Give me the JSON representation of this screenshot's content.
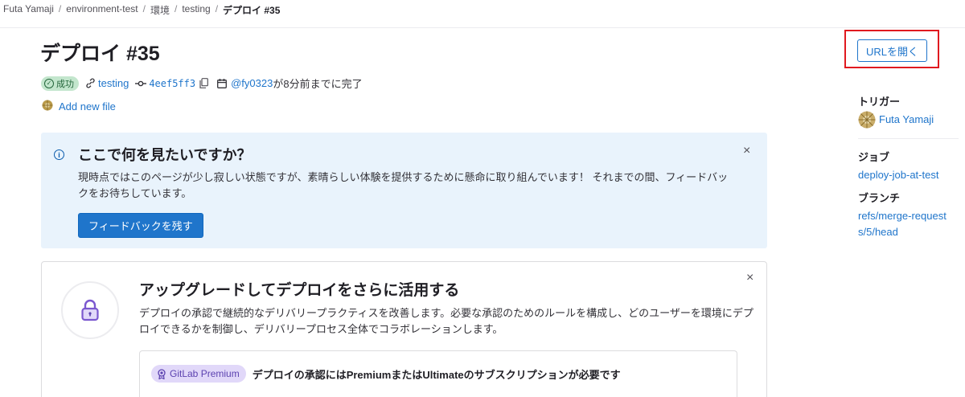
{
  "breadcrumb": [
    "Futa Yamaji",
    "environment-test",
    "環境",
    "testing",
    "デプロイ #35"
  ],
  "page": {
    "title": "デプロイ #35",
    "status": "成功",
    "environment": "testing",
    "commit": "4eef5ff3",
    "finished_by": "@fy0323",
    "finished_suffix": "が8分前までに完了",
    "add_file": "Add new file"
  },
  "feedback": {
    "title": "ここで何を見たいですか？",
    "body": "現時点ではこのページが少し寂しい状態ですが、素晴らしい体験を提供するために懸命に取り組んでいます！ それまでの間、フィードバックをお待ちしています。",
    "button": "フィードバックを残す"
  },
  "upgrade": {
    "title": "アップグレードしてデプロイをさらに活用する",
    "body": "デプロイの承認で継続的なデリバリープラクティスを改善します。必要な承認のためのルールを構成し、どのユーザーを環境にデプロイできるかを制御し、デリバリープロセス全体でコラボレーションします。",
    "premium_badge": "GitLab Premium",
    "premium_text": "デプロイの承認にはPremiumまたはUltimateのサブスクリプションが必要です"
  },
  "sidebar": {
    "open_url": "URLを開く",
    "trigger_label": "トリガー",
    "trigger_user": "Futa Yamaji",
    "job_label": "ジョブ",
    "job": "deploy-job-at-test",
    "branch_label": "ブランチ",
    "branch": "refs/merge-requests/5/head"
  },
  "close_glyph": "×",
  "colors": {
    "link": "#1f75cb",
    "success_bg": "#c3e6cd",
    "highlight_border": "#e0191f",
    "info_bg": "#e9f3fc"
  }
}
